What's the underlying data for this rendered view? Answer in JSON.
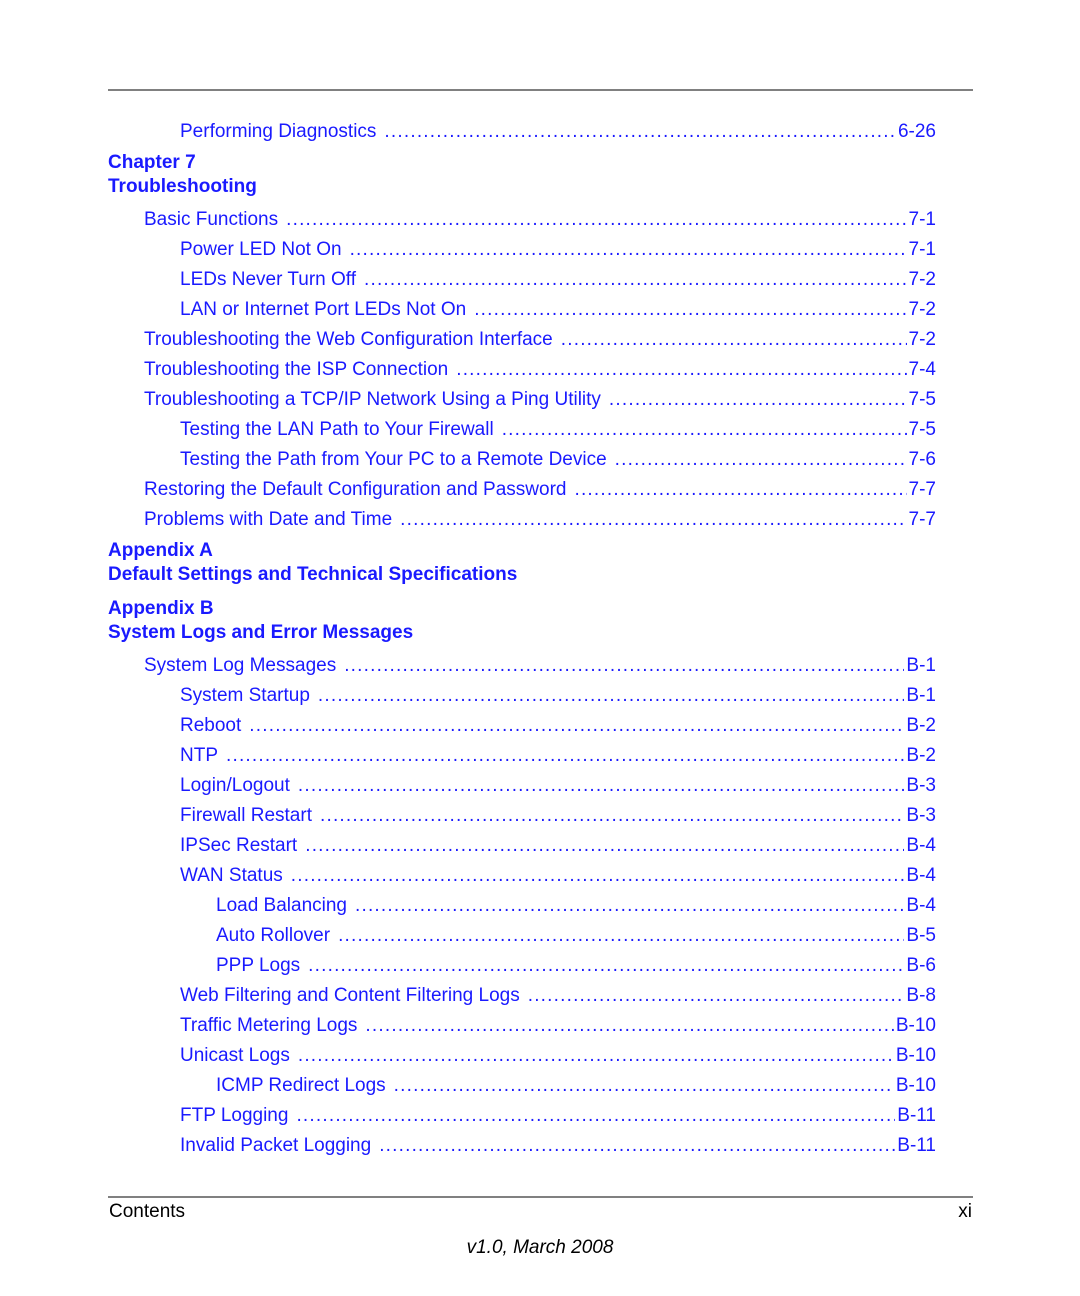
{
  "colors": {
    "link": "#1a1aff",
    "text": "#000000",
    "rule": "#808080"
  },
  "entries_top": [
    {
      "label": "Performing Diagnostics",
      "page": "6-26",
      "level": 2
    }
  ],
  "chapter7": {
    "number": "Chapter 7",
    "title": "Troubleshooting",
    "entries": [
      {
        "label": "Basic Functions",
        "page": "7-1",
        "level": 1
      },
      {
        "label": "Power LED Not On",
        "page": "7-1",
        "level": 2
      },
      {
        "label": "LEDs Never Turn Off",
        "page": "7-2",
        "level": 2
      },
      {
        "label": "LAN or Internet Port LEDs Not On",
        "page": "7-2",
        "level": 2
      },
      {
        "label": "Troubleshooting the Web Configuration Interface",
        "page": "7-2",
        "level": 1
      },
      {
        "label": "Troubleshooting the ISP Connection",
        "page": "7-4",
        "level": 1
      },
      {
        "label": "Troubleshooting a TCP/IP Network Using a Ping Utility",
        "page": "7-5",
        "level": 1
      },
      {
        "label": "Testing the LAN Path to Your Firewall",
        "page": "7-5",
        "level": 2
      },
      {
        "label": "Testing the Path from Your PC to a Remote Device",
        "page": "7-6",
        "level": 2
      },
      {
        "label": "Restoring the Default Configuration and Password",
        "page": "7-7",
        "level": 1
      },
      {
        "label": "Problems with Date and Time",
        "page": "7-7",
        "level": 1
      }
    ]
  },
  "appendixA": {
    "number": "Appendix A",
    "title": "Default Settings and Technical Specifications"
  },
  "appendixB": {
    "number": "Appendix B",
    "title": "System Logs and Error Messages",
    "entries": [
      {
        "label": "System Log Messages",
        "page": "B-1",
        "level": 1
      },
      {
        "label": "System Startup",
        "page": "B-1",
        "level": 2
      },
      {
        "label": "Reboot",
        "page": "B-2",
        "level": 2
      },
      {
        "label": "NTP",
        "page": "B-2",
        "level": 2
      },
      {
        "label": "Login/Logout",
        "page": "B-3",
        "level": 2
      },
      {
        "label": "Firewall Restart",
        "page": "B-3",
        "level": 2
      },
      {
        "label": "IPSec Restart",
        "page": "B-4",
        "level": 2
      },
      {
        "label": "WAN Status",
        "page": "B-4",
        "level": 2
      },
      {
        "label": "Load Balancing",
        "page": "B-4",
        "level": 3
      },
      {
        "label": "Auto Rollover",
        "page": "B-5",
        "level": 3
      },
      {
        "label": "PPP Logs",
        "page": "B-6",
        "level": 3
      },
      {
        "label": "Web Filtering and Content Filtering Logs",
        "page": "B-8",
        "level": 2
      },
      {
        "label": "Traffic Metering Logs",
        "page": "B-10",
        "level": 2
      },
      {
        "label": "Unicast Logs",
        "page": "B-10",
        "level": 2
      },
      {
        "label": "ICMP Redirect Logs",
        "page": "B-10",
        "level": 3
      },
      {
        "label": "FTP Logging",
        "page": "B-11",
        "level": 2
      },
      {
        "label": "Invalid Packet Logging",
        "page": "B-11",
        "level": 2
      }
    ]
  },
  "footer": {
    "section": "Contents",
    "page_number": "xi",
    "version": "v1.0, March 2008"
  }
}
